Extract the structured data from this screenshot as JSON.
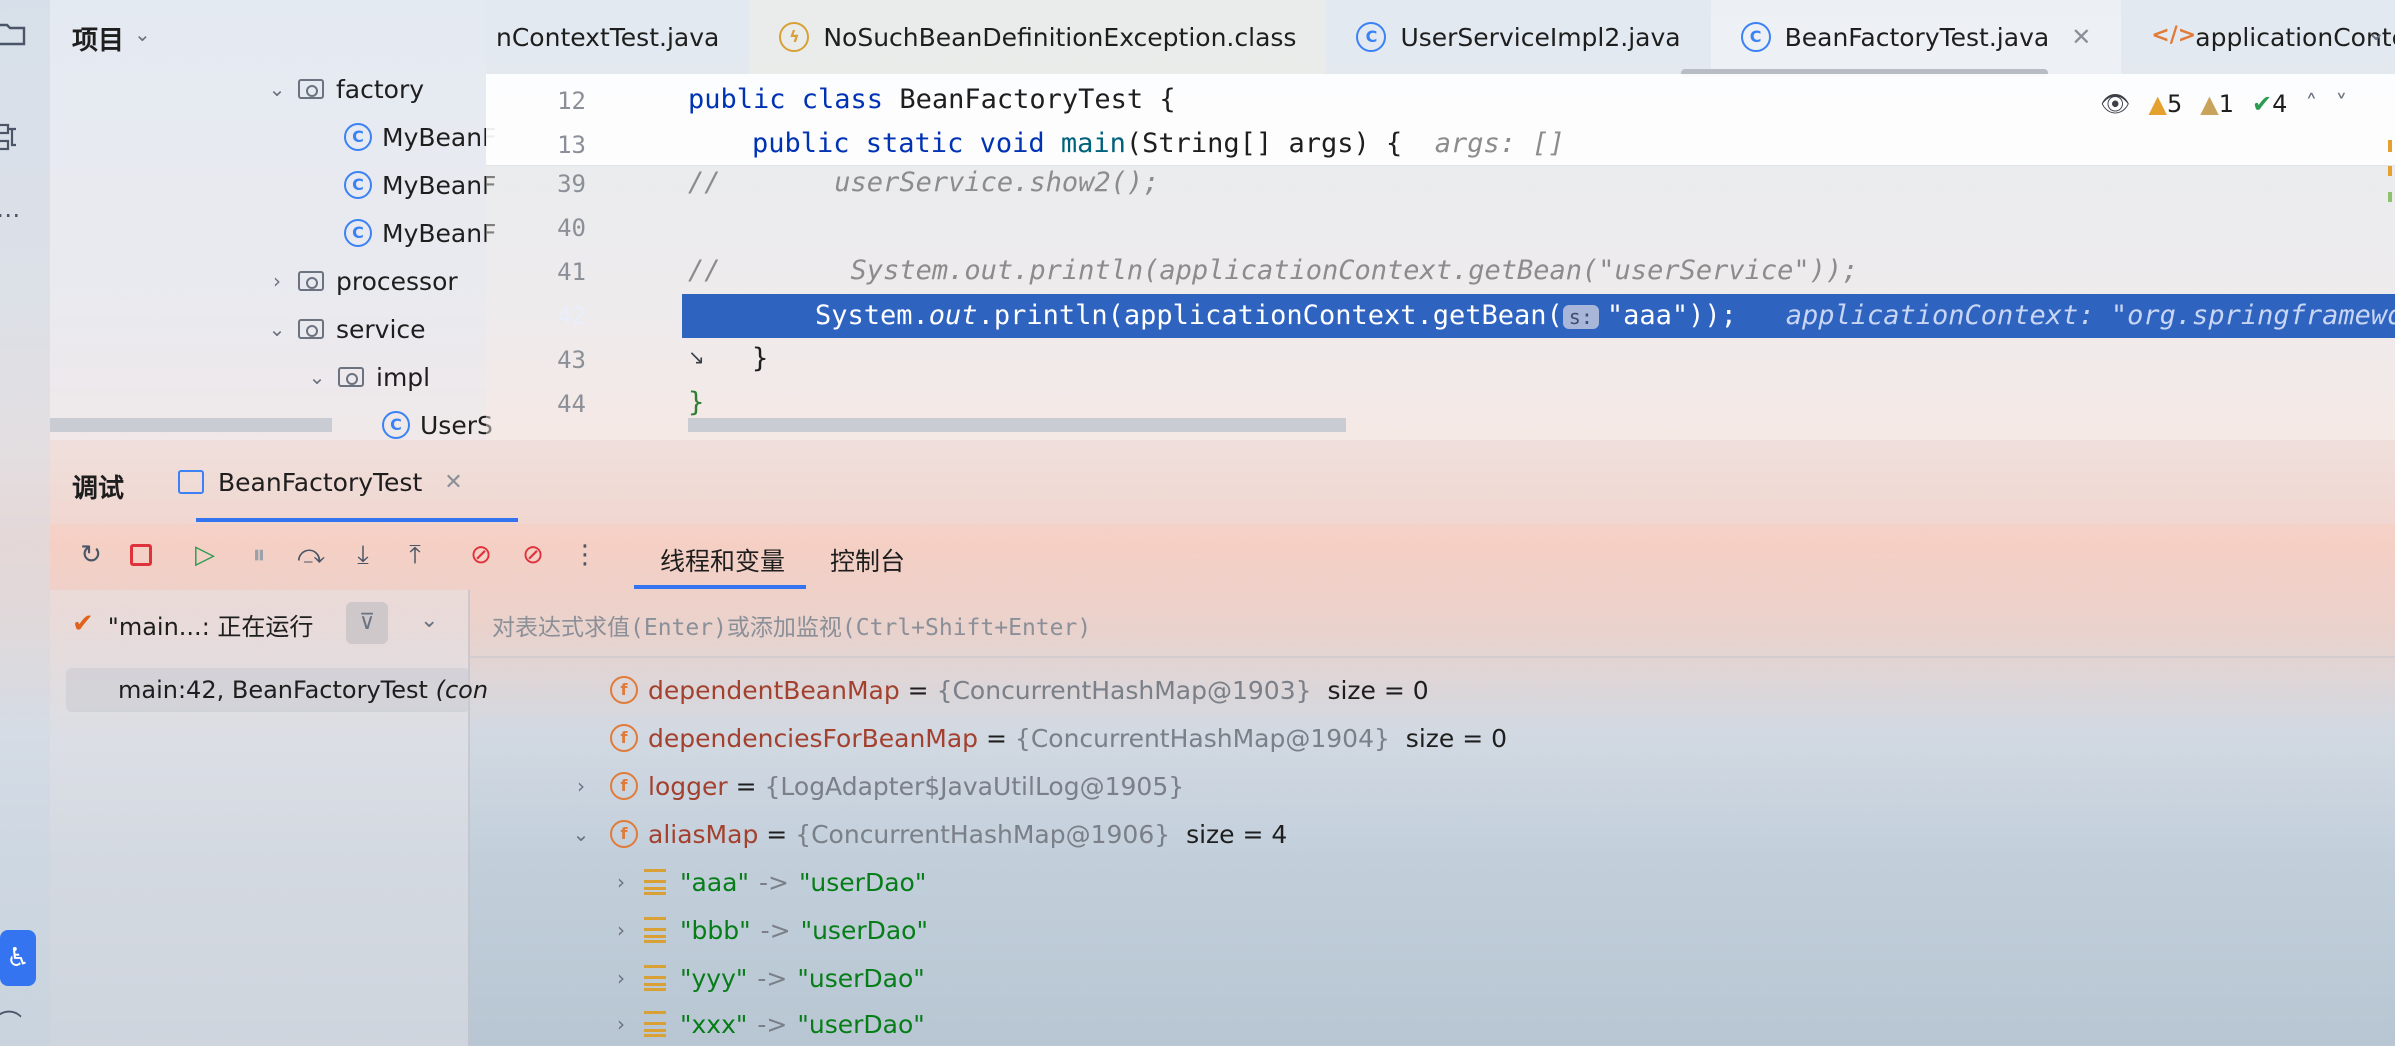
{
  "project": {
    "title": "项目",
    "tree": [
      {
        "label": "factory",
        "kind": "folder",
        "expanded": true
      },
      {
        "label": "MyBeanF",
        "kind": "class"
      },
      {
        "label": "MyBeanF",
        "kind": "class"
      },
      {
        "label": "MyBeanF",
        "kind": "class"
      },
      {
        "label": "processor",
        "kind": "folder",
        "expanded": false
      },
      {
        "label": "service",
        "kind": "folder",
        "expanded": true
      },
      {
        "label": "impl",
        "kind": "folder",
        "expanded": true
      },
      {
        "label": "UserS",
        "kind": "class"
      }
    ]
  },
  "tabs": [
    {
      "label": "nContextTest.java",
      "icon": "class-icon"
    },
    {
      "label": "NoSuchBeanDefinitionException.class",
      "icon": "exception-class-icon"
    },
    {
      "label": "UserServiceImpl2.java",
      "icon": "class-icon"
    },
    {
      "label": "BeanFactoryTest.java",
      "icon": "runnable-class-icon",
      "active": true
    },
    {
      "label": "applicationContextI",
      "icon": "xml-file-icon"
    }
  ],
  "editor": {
    "inspections": {
      "warnings": "5",
      "weak_warnings": "1",
      "ok": "4"
    },
    "sticky": [
      {
        "line": "12",
        "code": "public class BeanFactoryTest {"
      },
      {
        "line": "13",
        "code": "public static void main(String[] args) {",
        "hint": "args: []"
      }
    ],
    "lines": [
      {
        "line": "39",
        "code": "//       userService.show2();"
      },
      {
        "line": "40",
        "code": ""
      },
      {
        "line": "41",
        "code": "//        System.out.println(applicationContext.getBean(\"userService\"));"
      },
      {
        "line": "42",
        "code_prefix": "System.",
        "code_out": "out",
        "code_mid": ".println(applicationContext.getBean(",
        "chip": "s:",
        "arg": "\"aaa\"",
        "code_end": "));",
        "hint": "applicationContext: \"org.springframework"
      },
      {
        "line": "43",
        "code": "}"
      },
      {
        "line": "44",
        "code": "}"
      }
    ]
  },
  "debug": {
    "title": "调试",
    "session_tab": "BeanFactoryTest",
    "view_tabs": [
      "线程和变量",
      "控制台"
    ],
    "thread_status": "\"main...: 正在运行",
    "frame": "main:42, BeanFactoryTest",
    "frame_suffix": "(con",
    "eval_placeholder": "对表达式求值(Enter)或添加监视(Ctrl+Shift+Enter)",
    "variables": [
      {
        "name": "dependentBeanMap",
        "eq": "=",
        "type": "{ConcurrentHashMap@1903}",
        "extra": "size = 0",
        "expandable": false
      },
      {
        "name": "dependenciesForBeanMap",
        "eq": "=",
        "type": "{ConcurrentHashMap@1904}",
        "extra": "size = 0",
        "expandable": false
      },
      {
        "name": "logger",
        "eq": "=",
        "type": "{LogAdapter$JavaUtilLog@1905}",
        "extra": "",
        "expandable": true,
        "expanded": false
      },
      {
        "name": "aliasMap",
        "eq": "=",
        "type": "{ConcurrentHashMap@1906}",
        "extra": "size = 4",
        "expandable": true,
        "expanded": true
      }
    ],
    "entries": [
      {
        "key": "\"aaa\"",
        "arrow": "->",
        "value": "\"userDao\""
      },
      {
        "key": "\"bbb\"",
        "arrow": "->",
        "value": "\"userDao\""
      },
      {
        "key": "\"yyy\"",
        "arrow": "->",
        "value": "\"userDao\""
      },
      {
        "key": "\"xxx\"",
        "arrow": "->",
        "value": "\"userDao\""
      }
    ]
  },
  "colors": {
    "accent": "#2f63c0",
    "keyword": "#0033b3",
    "string": "#067d17",
    "field": "#a3402e",
    "stop": "#e0323c"
  }
}
